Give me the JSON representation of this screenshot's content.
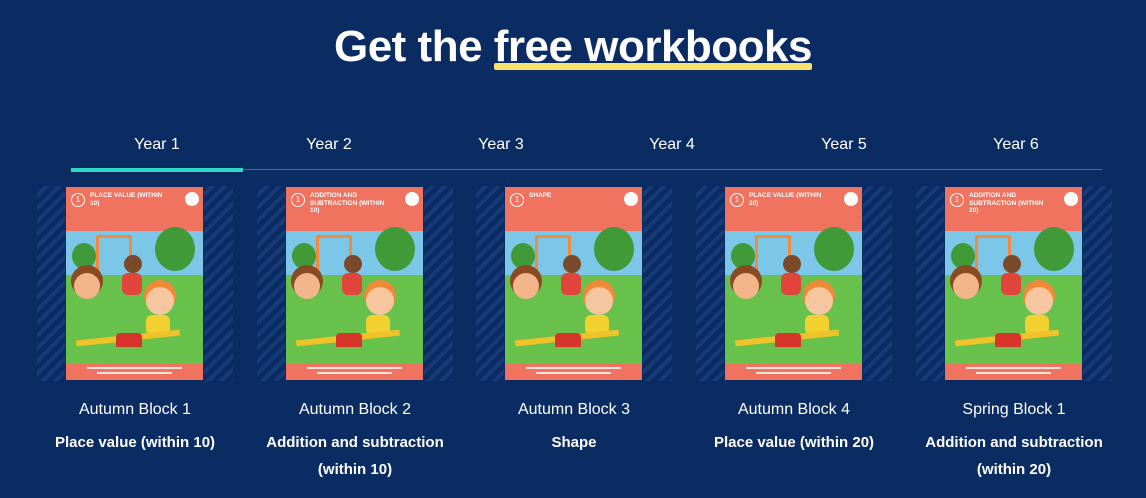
{
  "heading": {
    "prefix": "Get the ",
    "highlight": "free workbooks"
  },
  "tabs": [
    "Year 1",
    "Year 2",
    "Year 3",
    "Year 4",
    "Year 5",
    "Year 6"
  ],
  "active_tab": "Year 1",
  "colors": {
    "background": "#0b2c63",
    "tab_underline": "#2dd9c4",
    "highlight": "#f7e36b"
  },
  "cards": [
    {
      "cover_number": "1",
      "cover_title": "PLACE VALUE (WITHIN 10)",
      "block": "Autumn Block 1",
      "topic": "Place value (within 10)"
    },
    {
      "cover_number": "1",
      "cover_title": "ADDITION AND SUBTRACTION (WITHIN 10)",
      "block": "Autumn Block 2",
      "topic": "Addition and subtraction (within 10)"
    },
    {
      "cover_number": "1",
      "cover_title": "SHAPE",
      "block": "Autumn Block 3",
      "topic": "Shape"
    },
    {
      "cover_number": "1",
      "cover_title": "PLACE VALUE (WITHIN 20)",
      "block": "Autumn Block 4",
      "topic": "Place value (within 20)"
    },
    {
      "cover_number": "1",
      "cover_title": "ADDITION AND SUBTRACTION (WITHIN 20)",
      "block": "Spring Block 1",
      "topic": "Addition and subtraction (within 20)"
    }
  ]
}
